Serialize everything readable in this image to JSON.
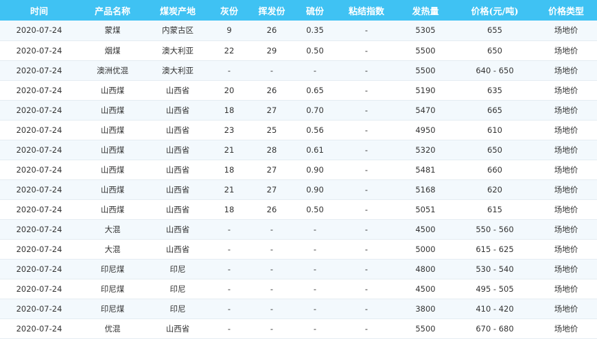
{
  "table": {
    "headers": [
      "时间",
      "产品名称",
      "煤炭产地",
      "灰份",
      "挥发份",
      "硫份",
      "粘结指数",
      "发热量",
      "价格(元/吨)",
      "价格类型"
    ],
    "rows": [
      [
        "2020-07-24",
        "蒙煤",
        "内蒙古区",
        "9",
        "26",
        "0.35",
        "-",
        "5305",
        "655",
        "场地价"
      ],
      [
        "2020-07-24",
        "烟煤",
        "澳大利亚",
        "22",
        "29",
        "0.50",
        "-",
        "5500",
        "650",
        "场地价"
      ],
      [
        "2020-07-24",
        "澳洲优混",
        "澳大利亚",
        "-",
        "-",
        "-",
        "-",
        "5500",
        "640 - 650",
        "场地价"
      ],
      [
        "2020-07-24",
        "山西煤",
        "山西省",
        "20",
        "26",
        "0.65",
        "-",
        "5190",
        "635",
        "场地价"
      ],
      [
        "2020-07-24",
        "山西煤",
        "山西省",
        "18",
        "27",
        "0.70",
        "-",
        "5470",
        "665",
        "场地价"
      ],
      [
        "2020-07-24",
        "山西煤",
        "山西省",
        "23",
        "25",
        "0.56",
        "-",
        "4950",
        "610",
        "场地价"
      ],
      [
        "2020-07-24",
        "山西煤",
        "山西省",
        "21",
        "28",
        "0.61",
        "-",
        "5320",
        "650",
        "场地价"
      ],
      [
        "2020-07-24",
        "山西煤",
        "山西省",
        "18",
        "27",
        "0.90",
        "-",
        "5481",
        "660",
        "场地价"
      ],
      [
        "2020-07-24",
        "山西煤",
        "山西省",
        "21",
        "27",
        "0.90",
        "-",
        "5168",
        "620",
        "场地价"
      ],
      [
        "2020-07-24",
        "山西煤",
        "山西省",
        "18",
        "26",
        "0.50",
        "-",
        "5051",
        "615",
        "场地价"
      ],
      [
        "2020-07-24",
        "大混",
        "山西省",
        "-",
        "-",
        "-",
        "-",
        "4500",
        "550 - 560",
        "场地价"
      ],
      [
        "2020-07-24",
        "大混",
        "山西省",
        "-",
        "-",
        "-",
        "-",
        "5000",
        "615 - 625",
        "场地价"
      ],
      [
        "2020-07-24",
        "印尼煤",
        "印尼",
        "-",
        "-",
        "-",
        "-",
        "4800",
        "530 - 540",
        "场地价"
      ],
      [
        "2020-07-24",
        "印尼煤",
        "印尼",
        "-",
        "-",
        "-",
        "-",
        "4500",
        "495 - 505",
        "场地价"
      ],
      [
        "2020-07-24",
        "印尼煤",
        "印尼",
        "-",
        "-",
        "-",
        "-",
        "3800",
        "410 - 420",
        "场地价"
      ],
      [
        "2020-07-24",
        "优混",
        "山西省",
        "-",
        "-",
        "-",
        "-",
        "5500",
        "670 - 680",
        "场地价"
      ]
    ]
  },
  "colors": {
    "header_bg": "#3fc2f3",
    "header_text": "#ffffff",
    "row_alt_bg": "#f3f9fd",
    "row_bg": "#ffffff",
    "cell_text": "#333333"
  }
}
